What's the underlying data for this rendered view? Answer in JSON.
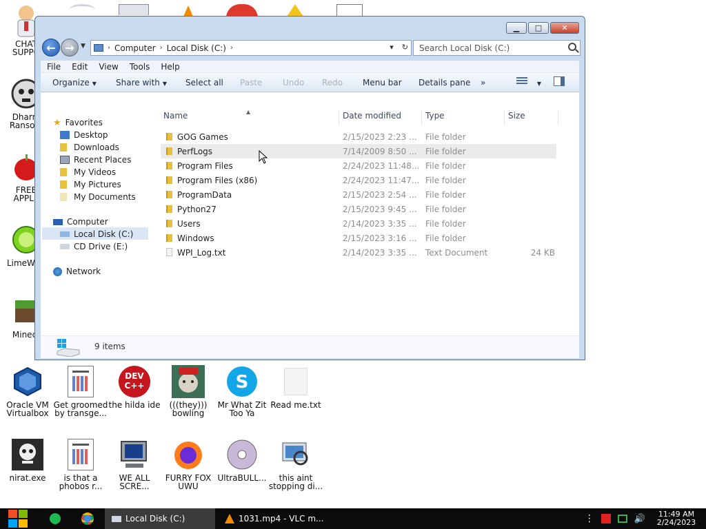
{
  "desktop": {
    "left_icons": [
      {
        "label": "CHAT\nSUPPO"
      },
      {
        "label": "Dharm\nRansom"
      },
      {
        "label": "FREE\nAPPLE"
      },
      {
        "label": "LimeWire"
      },
      {
        "label": "Minecr"
      }
    ],
    "row1": [
      {
        "label": "Oracle VM\nVirtualbox"
      },
      {
        "label": "Get groomed\nby transge..."
      },
      {
        "label": "the hilda ide"
      },
      {
        "label": "(((they)))\nbowling"
      },
      {
        "label": "Mr What Zit\nToo Ya"
      },
      {
        "label": "Read me.txt"
      }
    ],
    "row2": [
      {
        "label": "nirat.exe"
      },
      {
        "label": "is that a\nphobos r..."
      },
      {
        "label": "WE ALL\nSCRE..."
      },
      {
        "label": "FURRY FOX\nUWU"
      },
      {
        "label": "UltraBULL..."
      },
      {
        "label": "this aint\nstopping di..."
      }
    ],
    "dev_icon_text": "DEV\nC++"
  },
  "window": {
    "address": {
      "crumbs": [
        "Computer",
        "Local Disk (C:)"
      ]
    },
    "search_placeholder": "Search Local Disk (C:)",
    "menu": [
      "File",
      "Edit",
      "View",
      "Tools",
      "Help"
    ],
    "toolbar": {
      "organize": "Organize",
      "share_with": "Share with",
      "select_all": "Select all",
      "paste": "Paste",
      "undo": "Undo",
      "redo": "Redo",
      "menu_bar": "Menu bar",
      "details_pane": "Details pane",
      "more": "»"
    },
    "nav": {
      "favorites": "Favorites",
      "favorites_items": [
        "Desktop",
        "Downloads",
        "Recent Places",
        "My Videos",
        "My Pictures",
        "My Documents"
      ],
      "computer": "Computer",
      "computer_items": [
        "Local Disk (C:)",
        "CD Drive (E:)"
      ],
      "network": "Network"
    },
    "columns": {
      "name": "Name",
      "date": "Date modified",
      "type": "Type",
      "size": "Size"
    },
    "files": [
      {
        "name": "GOG Games",
        "date": "2/15/2023 2:23 ...",
        "type": "File folder",
        "size": ""
      },
      {
        "name": "PerfLogs",
        "date": "7/14/2009 8:50 ...",
        "type": "File folder",
        "size": ""
      },
      {
        "name": "Program Files",
        "date": "2/24/2023 11:48...",
        "type": "File folder",
        "size": ""
      },
      {
        "name": "Program Files (x86)",
        "date": "2/24/2023 11:47...",
        "type": "File folder",
        "size": ""
      },
      {
        "name": "ProgramData",
        "date": "2/15/2023 2:54 ...",
        "type": "File folder",
        "size": ""
      },
      {
        "name": "Python27",
        "date": "2/15/2023 9:45 ...",
        "type": "File folder",
        "size": ""
      },
      {
        "name": "Users",
        "date": "2/14/2023 3:35 ...",
        "type": "File folder",
        "size": ""
      },
      {
        "name": "Windows",
        "date": "2/15/2023 3:16 ...",
        "type": "File folder",
        "size": ""
      },
      {
        "name": "WPI_Log.txt",
        "date": "2/14/2023 3:35 ...",
        "type": "Text Document",
        "size": "24 KB"
      }
    ],
    "item_count": "9 items"
  },
  "taskbar": {
    "tasks": [
      "Local Disk (C:)",
      "1031.mp4 - VLC m..."
    ],
    "time": "11:49 AM",
    "date": "2/24/2023"
  }
}
